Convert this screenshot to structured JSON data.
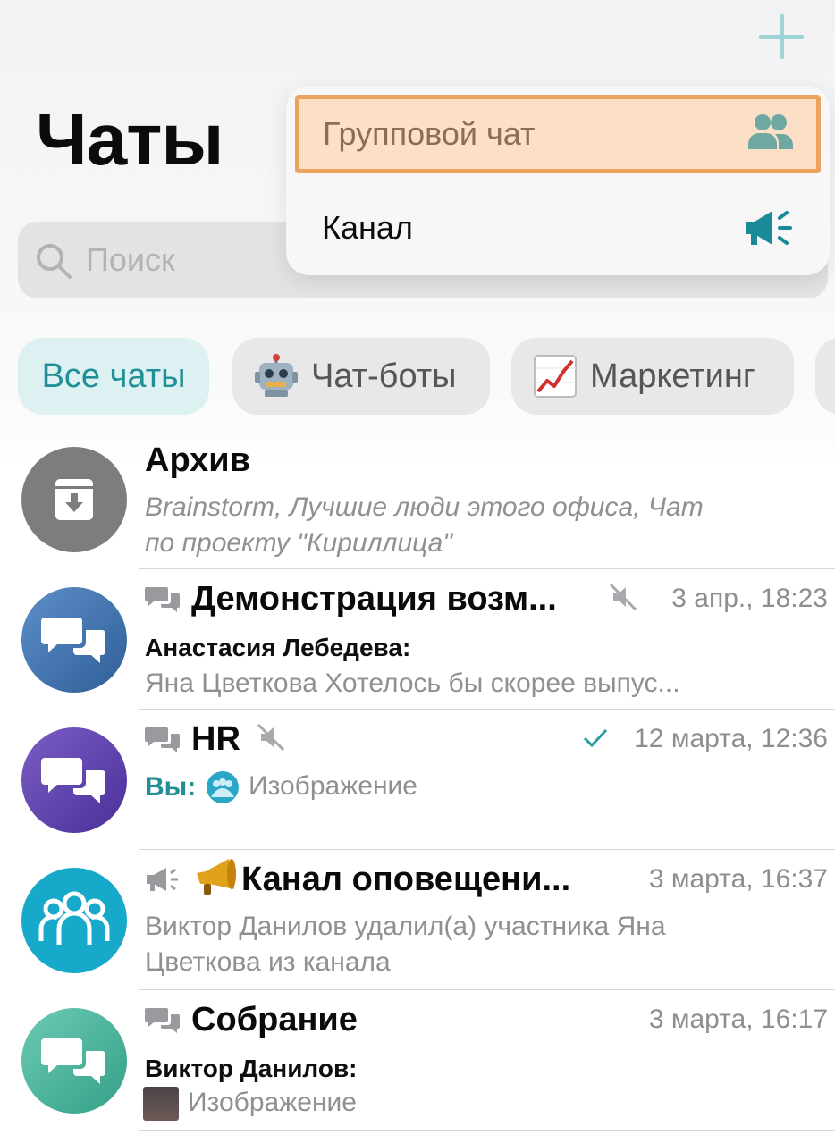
{
  "header": {
    "title": "Чаты",
    "add_icon": "plus-icon"
  },
  "search": {
    "placeholder": "Поиск",
    "icon": "search-icon"
  },
  "filters": [
    {
      "label": "Все чаты",
      "active": true
    },
    {
      "label": "Чат-боты",
      "icon": "robot-emoji"
    },
    {
      "label": "Маркетинг",
      "icon": "chart-increasing-emoji"
    }
  ],
  "dropdown": {
    "items": [
      {
        "label": "Групповой чат",
        "icon": "group-users-icon",
        "highlighted": true
      },
      {
        "label": "Канал",
        "icon": "megaphone-icon"
      }
    ]
  },
  "chats": [
    {
      "name": "Архив",
      "preview": "Brainstorm, Лучшие люди этого офиса, Чат",
      "preview2": "по проекту \"Кириллица\"",
      "avatar": "archive-icon",
      "avatar_color": "#7d7d7f"
    },
    {
      "name": "Демонстрация возм...",
      "time": "3 апр., 18:23",
      "muted": true,
      "sender": "Анастасия Лебедева:",
      "preview": "Яна Цветкова Хотелось бы скорее выпус...",
      "avatar": "group-chat-icon",
      "avatar_color": "#3f6fa6"
    },
    {
      "name": "HR",
      "time": "12 марта, 12:36",
      "muted": true,
      "read": true,
      "sender": "Вы:",
      "preview": "Изображение",
      "avatar": "group-chat-icon",
      "avatar_color": "#5a3fa8"
    },
    {
      "name": "Канал оповещени...",
      "time": "3 марта, 16:37",
      "preview": "Виктор Данилов удалил(а) участника Яна",
      "preview2": "Цветкова из канала",
      "avatar": "people-group-icon",
      "avatar_color": "#17a9c9"
    },
    {
      "name": "Собрание",
      "time": "3 марта, 16:17",
      "sender": "Виктор Данилов:",
      "preview": "Изображение",
      "avatar": "group-chat-icon",
      "avatar_color": "#4fb8a0"
    }
  ]
}
